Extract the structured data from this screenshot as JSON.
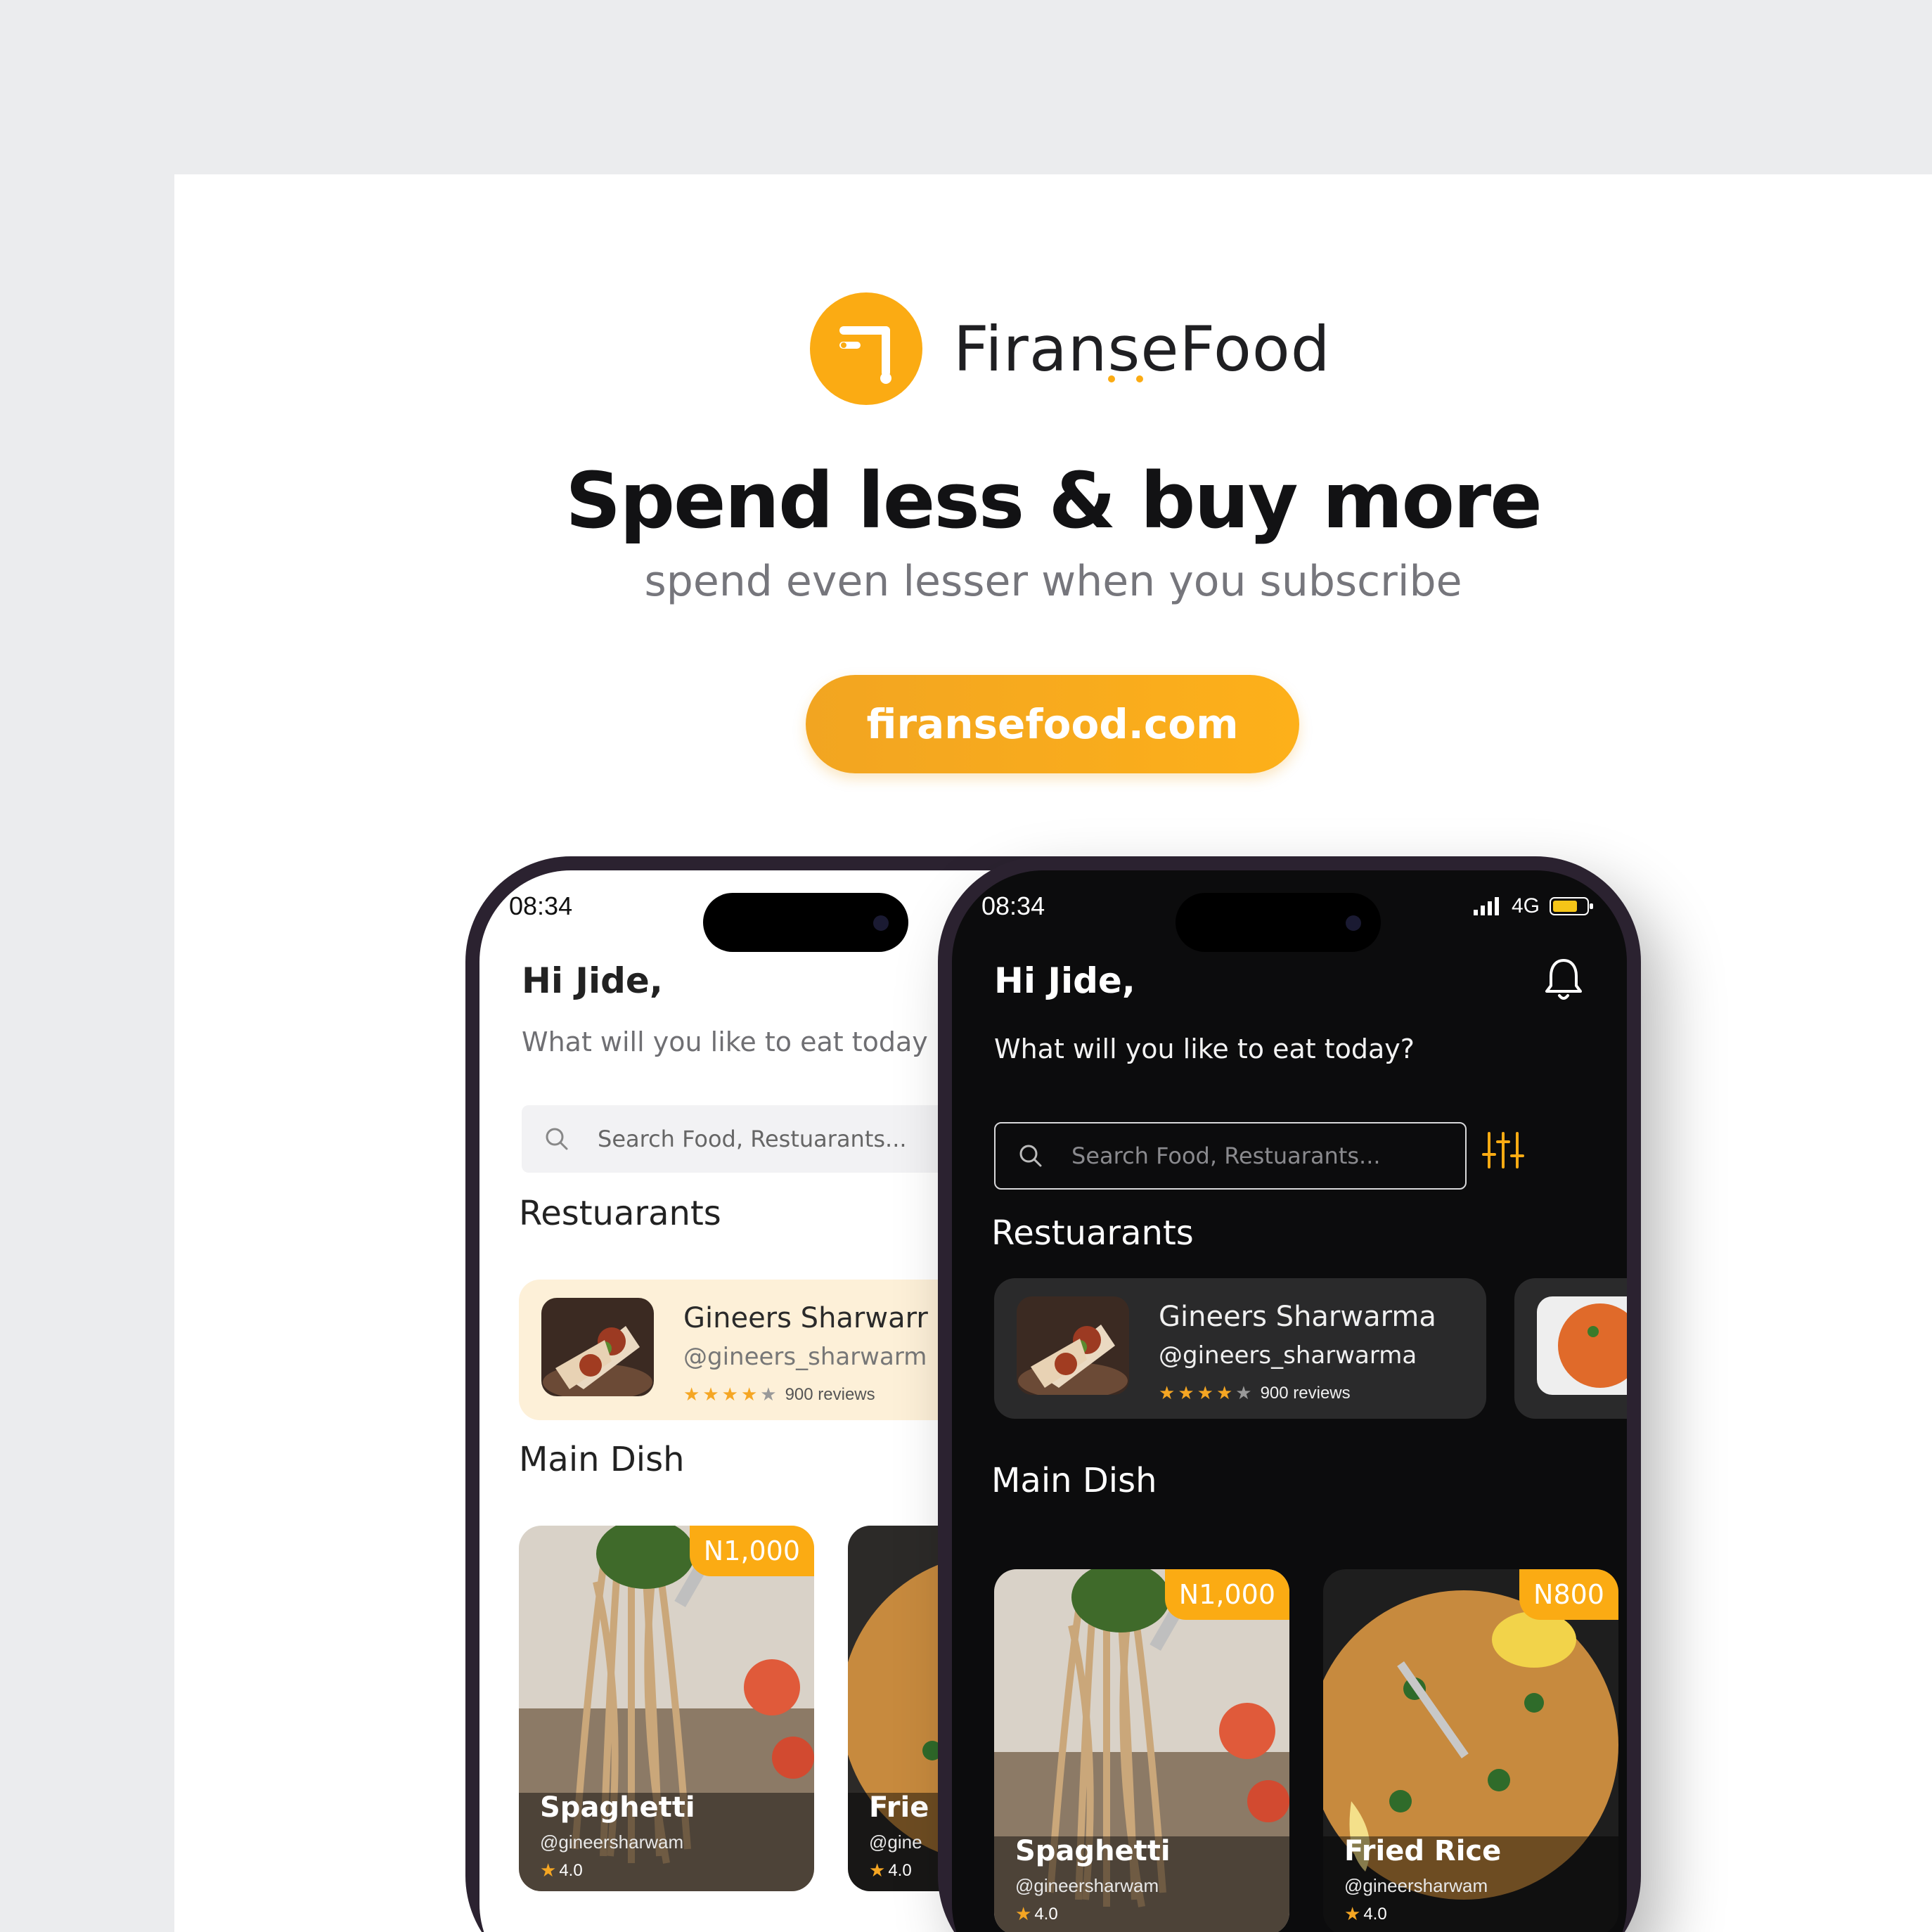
{
  "brand": {
    "name": "FiranseFood"
  },
  "hero": {
    "headline": "Spend less & buy more",
    "subline": "spend even lesser when you subscribe",
    "cta": "firansefood.com"
  },
  "phone_light": {
    "time": "08:34",
    "greeting": "Hi Jide,",
    "prompt": "What will you like to eat today",
    "search_placeholder": "Search Food, Restuarants...",
    "restaurants_title": "Restuarants",
    "restaurant": {
      "name": "Gineers Sharwarr",
      "handle": "@gineers_sharwarm",
      "reviews": "900 reviews",
      "rating": 4
    },
    "main_dish_title": "Main Dish",
    "dishes": [
      {
        "name": "Spaghetti",
        "handle": "@gineersharwam",
        "rating": "4.0",
        "price": "N1,000"
      },
      {
        "name": "Frie",
        "handle": "@gine",
        "rating": "4.0",
        "price": ""
      }
    ]
  },
  "phone_dark": {
    "time": "08:34",
    "network": "4G",
    "greeting": "Hi Jide,",
    "prompt": "What will you like to eat today?",
    "search_placeholder": "Search Food, Restuarants...",
    "restaurants_title": "Restuarants",
    "restaurant": {
      "name": "Gineers Sharwarma",
      "handle": "@gineers_sharwarma",
      "reviews": "900 reviews",
      "rating": 4
    },
    "main_dish_title": "Main Dish",
    "dishes": [
      {
        "name": "Spaghetti",
        "handle": "@gineersharwam",
        "rating": "4.0",
        "price": "N1,000"
      },
      {
        "name": "Fried Rice",
        "handle": "@gineersharwam",
        "rating": "4.0",
        "price": "N800"
      }
    ]
  },
  "colors": {
    "accent": "#fbab13",
    "dark_bg": "#0c0c0d",
    "dark_card": "#2a2a2b",
    "light_card": "#fdf0d8"
  }
}
